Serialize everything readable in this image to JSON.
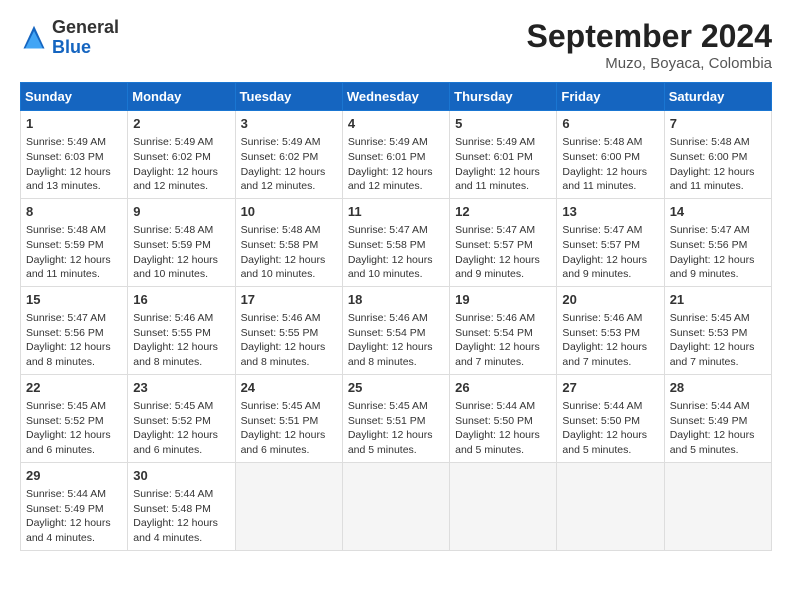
{
  "header": {
    "logo_general": "General",
    "logo_blue": "Blue",
    "title": "September 2024",
    "subtitle": "Muzo, Boyaca, Colombia"
  },
  "days_of_week": [
    "Sunday",
    "Monday",
    "Tuesday",
    "Wednesday",
    "Thursday",
    "Friday",
    "Saturday"
  ],
  "weeks": [
    [
      {
        "day": "1",
        "detail": "Sunrise: 5:49 AM\nSunset: 6:03 PM\nDaylight: 12 hours\nand 13 minutes."
      },
      {
        "day": "2",
        "detail": "Sunrise: 5:49 AM\nSunset: 6:02 PM\nDaylight: 12 hours\nand 12 minutes."
      },
      {
        "day": "3",
        "detail": "Sunrise: 5:49 AM\nSunset: 6:02 PM\nDaylight: 12 hours\nand 12 minutes."
      },
      {
        "day": "4",
        "detail": "Sunrise: 5:49 AM\nSunset: 6:01 PM\nDaylight: 12 hours\nand 12 minutes."
      },
      {
        "day": "5",
        "detail": "Sunrise: 5:49 AM\nSunset: 6:01 PM\nDaylight: 12 hours\nand 11 minutes."
      },
      {
        "day": "6",
        "detail": "Sunrise: 5:48 AM\nSunset: 6:00 PM\nDaylight: 12 hours\nand 11 minutes."
      },
      {
        "day": "7",
        "detail": "Sunrise: 5:48 AM\nSunset: 6:00 PM\nDaylight: 12 hours\nand 11 minutes."
      }
    ],
    [
      {
        "day": "8",
        "detail": "Sunrise: 5:48 AM\nSunset: 5:59 PM\nDaylight: 12 hours\nand 11 minutes."
      },
      {
        "day": "9",
        "detail": "Sunrise: 5:48 AM\nSunset: 5:59 PM\nDaylight: 12 hours\nand 10 minutes."
      },
      {
        "day": "10",
        "detail": "Sunrise: 5:48 AM\nSunset: 5:58 PM\nDaylight: 12 hours\nand 10 minutes."
      },
      {
        "day": "11",
        "detail": "Sunrise: 5:47 AM\nSunset: 5:58 PM\nDaylight: 12 hours\nand 10 minutes."
      },
      {
        "day": "12",
        "detail": "Sunrise: 5:47 AM\nSunset: 5:57 PM\nDaylight: 12 hours\nand 9 minutes."
      },
      {
        "day": "13",
        "detail": "Sunrise: 5:47 AM\nSunset: 5:57 PM\nDaylight: 12 hours\nand 9 minutes."
      },
      {
        "day": "14",
        "detail": "Sunrise: 5:47 AM\nSunset: 5:56 PM\nDaylight: 12 hours\nand 9 minutes."
      }
    ],
    [
      {
        "day": "15",
        "detail": "Sunrise: 5:47 AM\nSunset: 5:56 PM\nDaylight: 12 hours\nand 8 minutes."
      },
      {
        "day": "16",
        "detail": "Sunrise: 5:46 AM\nSunset: 5:55 PM\nDaylight: 12 hours\nand 8 minutes."
      },
      {
        "day": "17",
        "detail": "Sunrise: 5:46 AM\nSunset: 5:55 PM\nDaylight: 12 hours\nand 8 minutes."
      },
      {
        "day": "18",
        "detail": "Sunrise: 5:46 AM\nSunset: 5:54 PM\nDaylight: 12 hours\nand 8 minutes."
      },
      {
        "day": "19",
        "detail": "Sunrise: 5:46 AM\nSunset: 5:54 PM\nDaylight: 12 hours\nand 7 minutes."
      },
      {
        "day": "20",
        "detail": "Sunrise: 5:46 AM\nSunset: 5:53 PM\nDaylight: 12 hours\nand 7 minutes."
      },
      {
        "day": "21",
        "detail": "Sunrise: 5:45 AM\nSunset: 5:53 PM\nDaylight: 12 hours\nand 7 minutes."
      }
    ],
    [
      {
        "day": "22",
        "detail": "Sunrise: 5:45 AM\nSunset: 5:52 PM\nDaylight: 12 hours\nand 6 minutes."
      },
      {
        "day": "23",
        "detail": "Sunrise: 5:45 AM\nSunset: 5:52 PM\nDaylight: 12 hours\nand 6 minutes."
      },
      {
        "day": "24",
        "detail": "Sunrise: 5:45 AM\nSunset: 5:51 PM\nDaylight: 12 hours\nand 6 minutes."
      },
      {
        "day": "25",
        "detail": "Sunrise: 5:45 AM\nSunset: 5:51 PM\nDaylight: 12 hours\nand 5 minutes."
      },
      {
        "day": "26",
        "detail": "Sunrise: 5:44 AM\nSunset: 5:50 PM\nDaylight: 12 hours\nand 5 minutes."
      },
      {
        "day": "27",
        "detail": "Sunrise: 5:44 AM\nSunset: 5:50 PM\nDaylight: 12 hours\nand 5 minutes."
      },
      {
        "day": "28",
        "detail": "Sunrise: 5:44 AM\nSunset: 5:49 PM\nDaylight: 12 hours\nand 5 minutes."
      }
    ],
    [
      {
        "day": "29",
        "detail": "Sunrise: 5:44 AM\nSunset: 5:49 PM\nDaylight: 12 hours\nand 4 minutes."
      },
      {
        "day": "30",
        "detail": "Sunrise: 5:44 AM\nSunset: 5:48 PM\nDaylight: 12 hours\nand 4 minutes."
      },
      {
        "day": "",
        "detail": ""
      },
      {
        "day": "",
        "detail": ""
      },
      {
        "day": "",
        "detail": ""
      },
      {
        "day": "",
        "detail": ""
      },
      {
        "day": "",
        "detail": ""
      }
    ]
  ]
}
